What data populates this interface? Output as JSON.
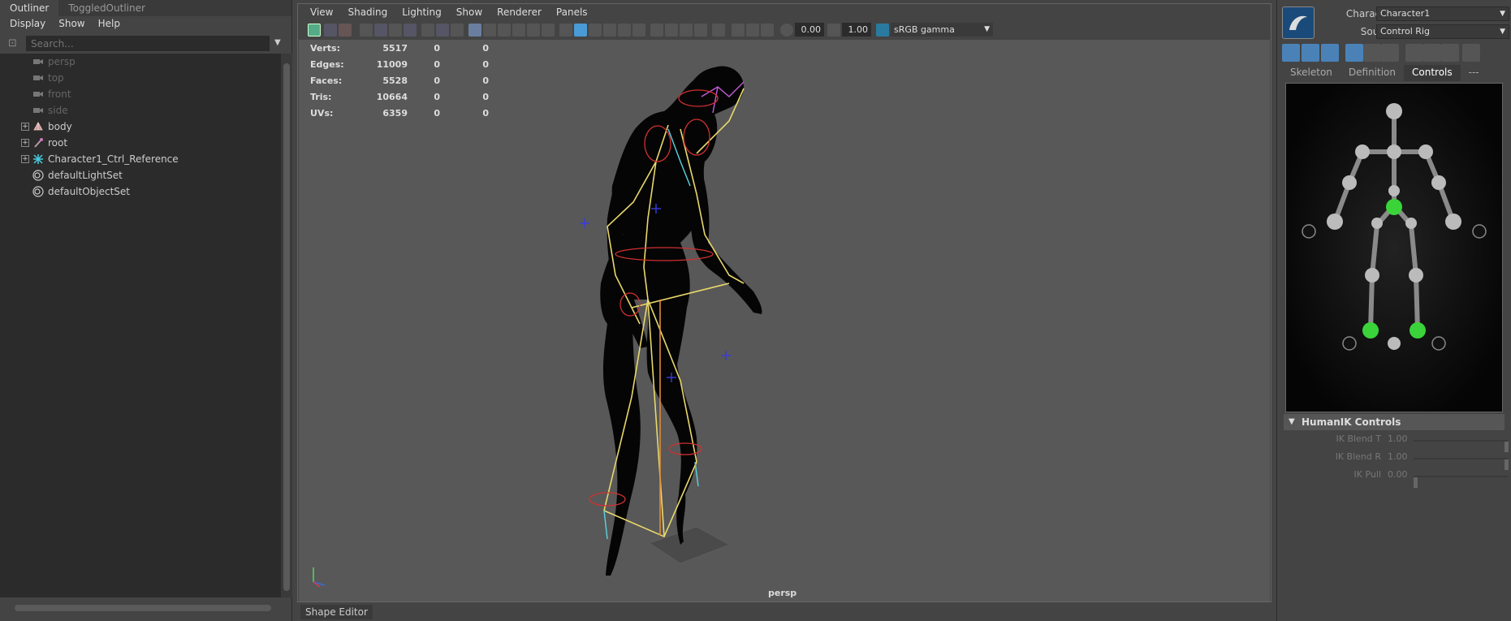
{
  "outliner": {
    "tabs": [
      "Outliner",
      "ToggledOutliner"
    ],
    "menus": [
      "Display",
      "Show",
      "Help"
    ],
    "search_placeholder": "Search...",
    "items": [
      {
        "label": "persp",
        "icon": "camera-icon",
        "dim": true,
        "expandable": false
      },
      {
        "label": "top",
        "icon": "camera-icon",
        "dim": true,
        "expandable": false
      },
      {
        "label": "front",
        "icon": "camera-icon",
        "dim": true,
        "expandable": false
      },
      {
        "label": "side",
        "icon": "camera-icon",
        "dim": true,
        "expandable": false
      },
      {
        "label": "body",
        "icon": "mesh-icon",
        "dim": false,
        "expandable": true
      },
      {
        "label": "root",
        "icon": "joint-icon",
        "dim": false,
        "expandable": true
      },
      {
        "label": "Character1_Ctrl_Reference",
        "icon": "hik-reference-icon",
        "dim": false,
        "expandable": true
      },
      {
        "label": "defaultLightSet",
        "icon": "set-icon",
        "dim": false,
        "expandable": false
      },
      {
        "label": "defaultObjectSet",
        "icon": "set-icon",
        "dim": false,
        "expandable": false
      }
    ]
  },
  "viewport": {
    "menus": [
      "View",
      "Shading",
      "Lighting",
      "Show",
      "Renderer",
      "Panels"
    ],
    "exposure_value": "0.00",
    "gamma_value": "1.00",
    "color_space": "sRGB gamma",
    "camera_label": "persp",
    "hud": [
      {
        "label": "Verts:",
        "v1": "5517",
        "v2": "0",
        "v3": "0"
      },
      {
        "label": "Edges:",
        "v1": "11009",
        "v2": "0",
        "v3": "0"
      },
      {
        "label": "Faces:",
        "v1": "5528",
        "v2": "0",
        "v3": "0"
      },
      {
        "label": "Tris:",
        "v1": "10664",
        "v2": "0",
        "v3": "0"
      },
      {
        "label": "UVs:",
        "v1": "6359",
        "v2": "0",
        "v3": "0"
      }
    ]
  },
  "bottom": {
    "shape_editor": "Shape Editor"
  },
  "humanik": {
    "character_label": "Character:",
    "character_value": "Character1",
    "source_label": "Source:",
    "source_value": "Control Rig",
    "tabs": [
      "Skeleton",
      "Definition",
      "Controls",
      "---"
    ],
    "active_tab": "Controls",
    "section_title": "HumanIK Controls",
    "sliders": [
      {
        "label": "IK Blend T",
        "value": "1.00"
      },
      {
        "label": "IK Blend R",
        "value": "1.00"
      },
      {
        "label": "IK Pull",
        "value": "0.00"
      }
    ]
  }
}
